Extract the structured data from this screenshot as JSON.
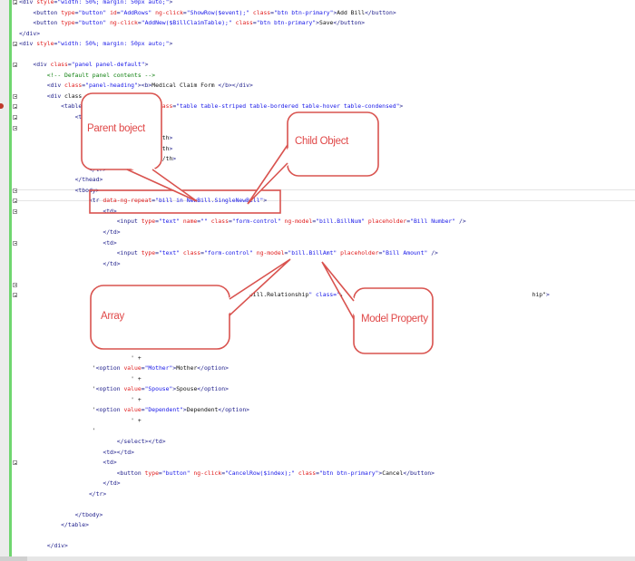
{
  "editor": {
    "lines": [
      "<div style=\"width: 50%; margin: 50px auto;\">",
      "    <button type=\"button\" id=\"AddRows\" ng-click=\"ShowRow($event);\" class=\"btn btn-primary\">Add Bill</button>",
      "    <button type=\"button\" ng-click=\"AddNew($BillClaimTable);\" class=\"btn btn-primary\">Save</button>",
      "</div>",
      "<div style=\"width: 50%; margin: 50px auto;\">",
      "",
      "    <div class=\"panel panel-default\">",
      "        <!-- Default panel contents -->",
      "        <div class=\"panel-heading\"><b>Medical Claim Form </b></div>",
      "        <div class",
      "            <table                       ass=\"table table-striped table-bordered table-hover table-condensed\">",
      "                <t",
      "",
      "                                         th>",
      "                                         th>",
      "                                         /th>",
      "                    </tr>",
      "                </thead>",
      "                <tbody>",
      "                    <tr data-ng-repeat=\"bill in NewBill.SingleNewBill\">",
      "                        <td>",
      "                            <input type=\"text\" name=\"\" class=\"form-control\" ng-model=\"bill.BillNum\" placeholder=\"Bill Number\" />",
      "                        </td>",
      "                        <td>",
      "                            <input type=\"text\" class=\"form-control\" ng-model=\"bill.BillAmt\" placeholder=\"Bill Amount\" />",
      "                        </td>",
      "",
      "",
      "                                                                  bill.Relationship\" class=\"f                                                      hip\">",
      "",
      "",
      "",
      "",
      "",
      "                                ' +",
      "                     '<option value=\"Mother\">Mother</option>",
      "                                ' +",
      "                     '<option value=\"Spouse\">Spouse</option>",
      "                                ' +",
      "                     '<option value=\"Dependent\">Dependent</option>",
      "                                ' +",
      "                     '",
      "                            </select></td>",
      "                        <td></td>",
      "                        <td>",
      "                            <button type=\"button\" ng-click=\"CancelRow($index);\" class=\"btn btn-primary\">Cancel</button>",
      "                        </td>",
      "                    </tr>",
      "",
      "                </tbody>",
      "            </table>",
      "",
      "        </div>"
    ],
    "fold_lines": [
      0,
      4,
      6,
      9,
      10,
      11,
      12,
      18,
      19,
      20,
      23,
      27,
      28,
      44
    ]
  },
  "annotations": {
    "parent": "Parent boject",
    "child": "Child Object",
    "array": "Array",
    "model": "Model Property"
  },
  "colors": {
    "callout_border": "#d9534f",
    "callout_text": "#e04848"
  }
}
